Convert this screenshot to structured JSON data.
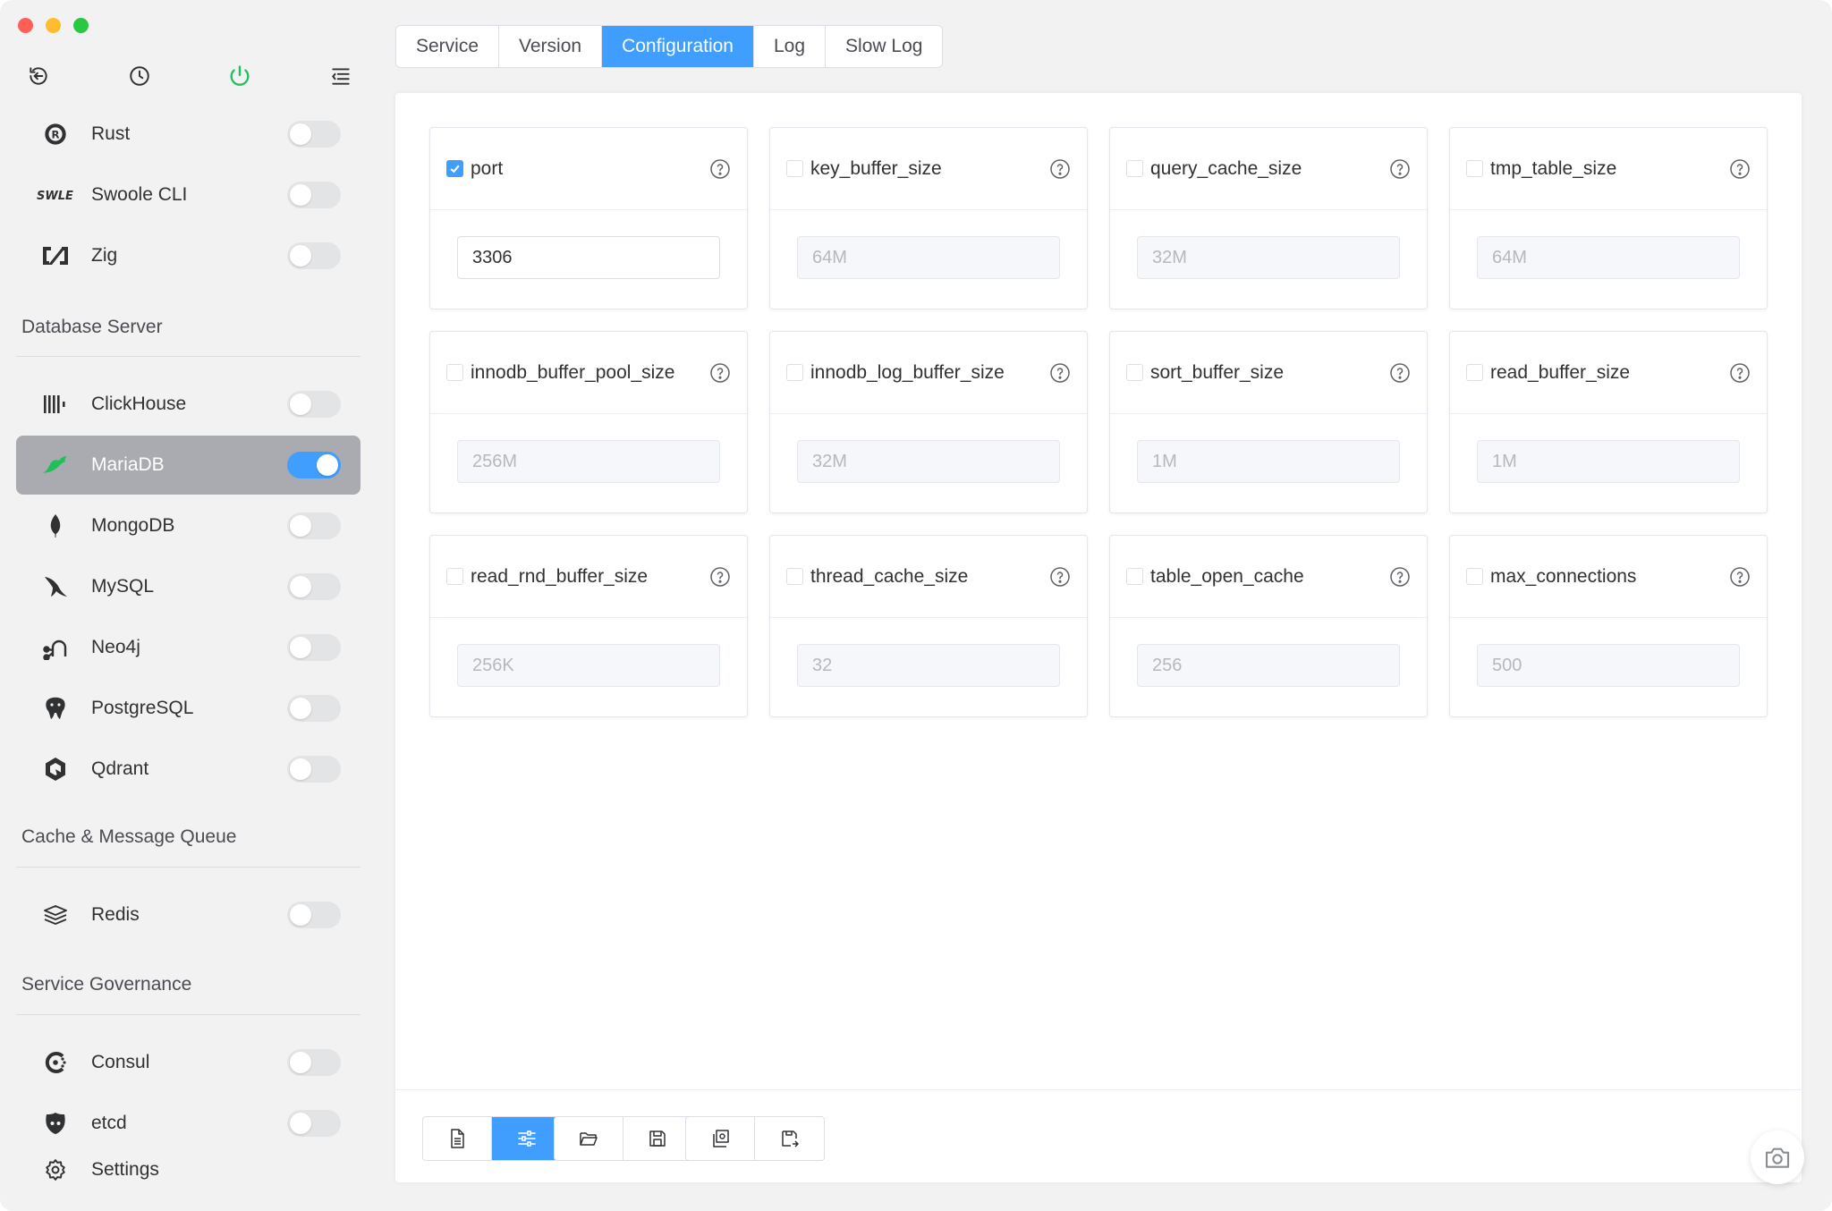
{
  "colors": {
    "accent": "#409eff",
    "active_sidebar": "#a9abb0",
    "power_icon": "#20c05c"
  },
  "sidebar": {
    "top_icons": [
      "back-icon",
      "clock-icon",
      "power-icon",
      "collapse-menu-icon"
    ],
    "items_top": [
      {
        "label": "Rust",
        "icon": "rust-icon",
        "enabled": false
      },
      {
        "label": "Swoole CLI",
        "icon": "swoole-icon",
        "enabled": false
      },
      {
        "label": "Zig",
        "icon": "zig-icon",
        "enabled": false
      }
    ],
    "section_database": "Database Server",
    "items_database": [
      {
        "label": "ClickHouse",
        "icon": "clickhouse-icon",
        "enabled": false
      },
      {
        "label": "MariaDB",
        "icon": "mariadb-icon",
        "enabled": true,
        "active": true
      },
      {
        "label": "MongoDB",
        "icon": "mongodb-icon",
        "enabled": false
      },
      {
        "label": "MySQL",
        "icon": "mysql-icon",
        "enabled": false
      },
      {
        "label": "Neo4j",
        "icon": "neo4j-icon",
        "enabled": false
      },
      {
        "label": "PostgreSQL",
        "icon": "postgresql-icon",
        "enabled": false
      },
      {
        "label": "Qdrant",
        "icon": "qdrant-icon",
        "enabled": false
      }
    ],
    "section_cache": "Cache & Message Queue",
    "items_cache": [
      {
        "label": "Redis",
        "icon": "redis-icon",
        "enabled": false
      }
    ],
    "section_governance": "Service Governance",
    "items_governance": [
      {
        "label": "Consul",
        "icon": "consul-icon",
        "enabled": false
      },
      {
        "label": "etcd",
        "icon": "etcd-icon",
        "enabled": false
      }
    ],
    "settings_label": "Settings"
  },
  "tabs": [
    {
      "label": "Service",
      "active": false
    },
    {
      "label": "Version",
      "active": false
    },
    {
      "label": "Configuration",
      "active": true
    },
    {
      "label": "Log",
      "active": false
    },
    {
      "label": "Slow Log",
      "active": false
    }
  ],
  "config": [
    {
      "name": "port",
      "value": "3306",
      "checked": true
    },
    {
      "name": "key_buffer_size",
      "value": "64M",
      "checked": false
    },
    {
      "name": "query_cache_size",
      "value": "32M",
      "checked": false
    },
    {
      "name": "tmp_table_size",
      "value": "64M",
      "checked": false
    },
    {
      "name": "innodb_buffer_pool_size",
      "value": "256M",
      "checked": false
    },
    {
      "name": "innodb_log_buffer_size",
      "value": "32M",
      "checked": false
    },
    {
      "name": "sort_buffer_size",
      "value": "1M",
      "checked": false
    },
    {
      "name": "read_buffer_size",
      "value": "1M",
      "checked": false
    },
    {
      "name": "read_rnd_buffer_size",
      "value": "256K",
      "checked": false
    },
    {
      "name": "thread_cache_size",
      "value": "32",
      "checked": false
    },
    {
      "name": "table_open_cache",
      "value": "256",
      "checked": false
    },
    {
      "name": "max_connections",
      "value": "500",
      "checked": false
    }
  ],
  "toolbar": {
    "group1": [
      "file-text-icon",
      "sliders-icon"
    ],
    "group2": [
      "folder-open-icon",
      "save-icon",
      "reset-icon"
    ],
    "group3": [
      "load-custom-icon",
      "save-custom-icon"
    ]
  },
  "floating": "camera-icon"
}
